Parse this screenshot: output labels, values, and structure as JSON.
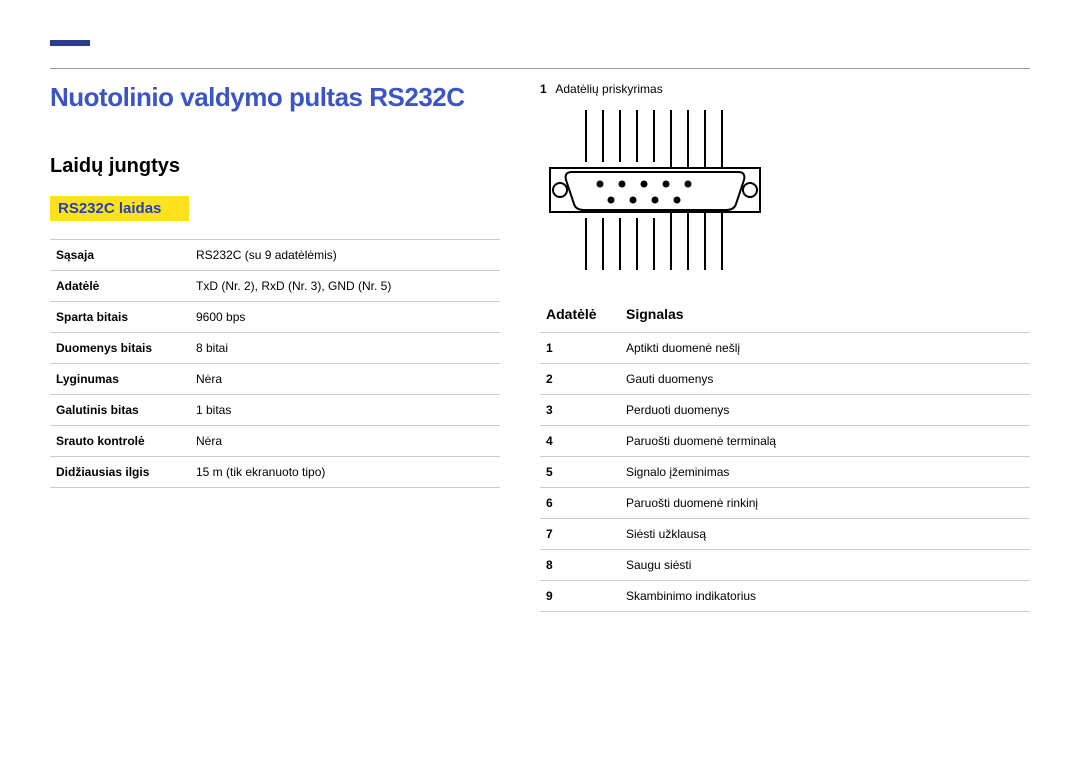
{
  "title": "Nuotolinio valdymo pultas RS232C",
  "subtitle": "Laidų jungtys",
  "cable_label": "RS232C laidas",
  "spec_rows": [
    {
      "k": "Sąsaja",
      "v": "RS232C (su 9 adatėlėmis)"
    },
    {
      "k": "Adatėlė",
      "v": "TxD (Nr. 2), RxD (Nr. 3), GND (Nr. 5)"
    },
    {
      "k": "Sparta bitais",
      "v": "9600 bps"
    },
    {
      "k": "Duomenys bitais",
      "v": "8 bitai"
    },
    {
      "k": "Lyginumas",
      "v": "Nėra"
    },
    {
      "k": "Galutinis bitas",
      "v": "1 bitas"
    },
    {
      "k": "Srauto kontrolė",
      "v": "Nėra"
    },
    {
      "k": "Didžiausias ilgis",
      "v": "15 m (tik ekranuoto tipo)"
    }
  ],
  "pin_caption_num": "1",
  "pin_caption_text": "Adatėlių priskyrimas",
  "pins_header_pin": "Adatėlė",
  "pins_header_signal": "Signalas",
  "pins": [
    {
      "n": "1",
      "s": "Aptikti duomenė nešlį"
    },
    {
      "n": "2",
      "s": "Gauti duomenys"
    },
    {
      "n": "3",
      "s": "Perduoti duomenys"
    },
    {
      "n": "4",
      "s": "Paruošti duomenė terminalą"
    },
    {
      "n": "5",
      "s": "Signalo įžeminimas"
    },
    {
      "n": "6",
      "s": "Paruošti duomenė rinkinį"
    },
    {
      "n": "7",
      "s": "Siėsti užklausą"
    },
    {
      "n": "8",
      "s": "Saugu siėsti"
    },
    {
      "n": "9",
      "s": "Skambinimo indikatorius"
    }
  ]
}
